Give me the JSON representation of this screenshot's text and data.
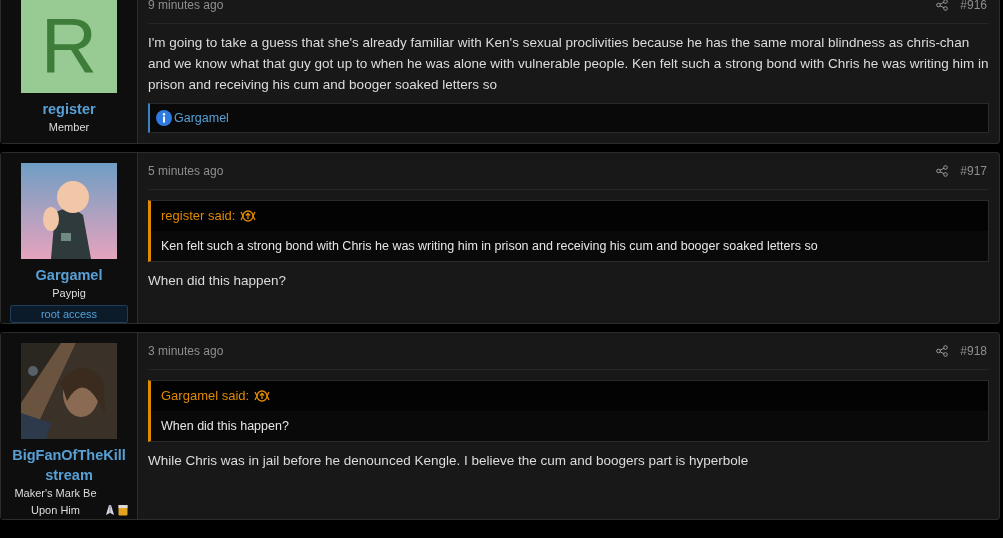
{
  "posts": [
    {
      "author": {
        "name": "register",
        "title": "Member",
        "avatar": {
          "kind": "letter",
          "letter": "R"
        }
      },
      "time": "9 minutes ago",
      "number": "#916",
      "body": "I'm going to take a guess that she's already familiar with Ken's sexual proclivities because he has the same moral blindness as chris-chan and we know what that guy got up to when he was alone with vulnerable people. Ken felt such a strong bond with Chris he was writing him in prison and receiving his cum and booger soaked letters so",
      "reactions": [
        "Gargamel"
      ]
    },
    {
      "author": {
        "name": "Gargamel",
        "title": "Paypig",
        "banner": "root access"
      },
      "time": "5 minutes ago",
      "number": "#917",
      "quote": {
        "attribution": "register said:",
        "text": "Ken felt such a strong bond with Chris he was writing him in prison and receiving his cum and booger soaked letters so"
      },
      "body": "When did this happen?"
    },
    {
      "author": {
        "name": "BigFanOfTheKill stream",
        "title": "Maker's Mark Be Upon Him"
      },
      "time": "3 minutes ago",
      "number": "#918",
      "quote": {
        "attribution": "Gargamel said:",
        "text": "When did this happen?"
      },
      "body": "While Chris was in jail before he denounced Kengle. I believe the cum and boogers part is hyperbole"
    }
  ]
}
